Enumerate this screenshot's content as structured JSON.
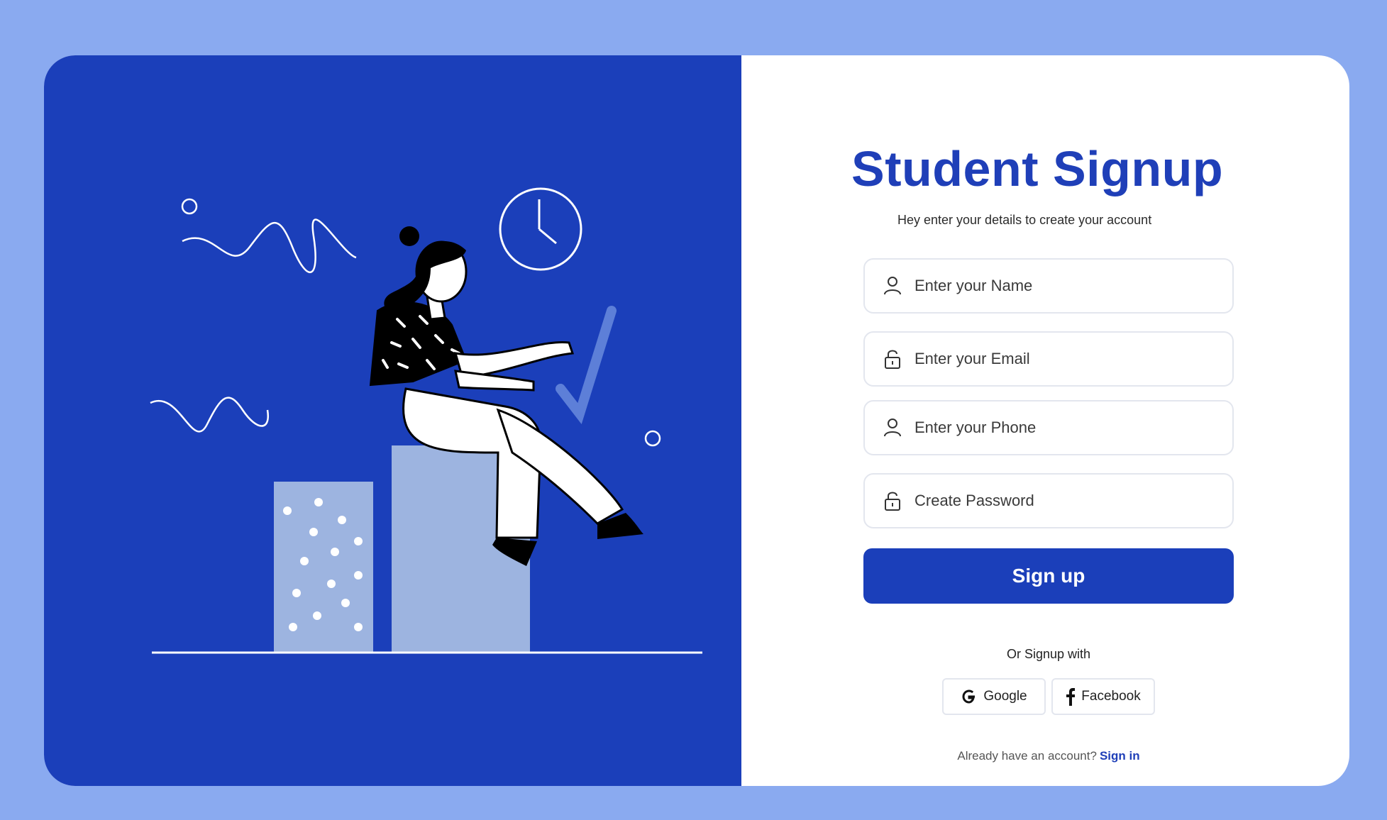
{
  "form": {
    "title": "Student Signup",
    "subtitle": "Hey enter your details to create your account",
    "fields": [
      {
        "placeholder": "Enter your Name",
        "icon": "user-icon"
      },
      {
        "placeholder": "Enter your Email",
        "icon": "lock-icon"
      },
      {
        "placeholder": "Enter your Phone",
        "icon": "user-icon"
      },
      {
        "placeholder": "Create Password",
        "icon": "lock-icon"
      }
    ],
    "submit_label": "Sign up",
    "or_text": "Or Signup with",
    "social": {
      "google_label": "Google",
      "facebook_label": "Facebook"
    },
    "footer_text": "Already have an account?",
    "signin_label": "Sign in"
  },
  "colors": {
    "background": "#8aaaf0",
    "panel": "#1b3fba",
    "accent": "#1f3fb8",
    "building": "#9db4e0"
  }
}
